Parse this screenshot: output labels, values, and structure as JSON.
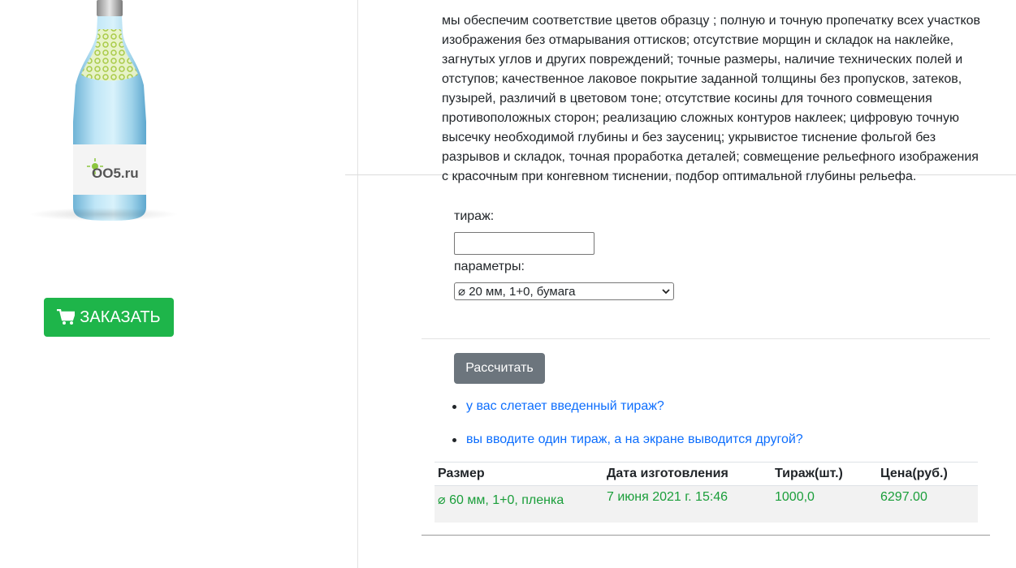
{
  "product": {
    "brand_label": "OO5.ru",
    "order_button_label": "ЗАКАЗАТЬ"
  },
  "description": {
    "lines": [
      "мы обеспечим соответствие цветов образцу ; полную и точную пропечатку всех участков",
      "изображения без отмарывания оттисков; отсутствие морщин и складок на наклейке,",
      "загнутых углов и других повреждений; точные размеры, наличие технических полей и",
      "отступов; качественное лаковое покрытие заданной толщины без пропусков, затеков,",
      "пузырей, различий в цветовом тоне; отсутствие косины для точного совмещения",
      "противоположных сторон; реализацию сложных контуров наклеек; цифровую точную",
      "высечку необходимой глубины и без заусениц; укрывистое тиснение фольгой без",
      "разрывов и складок, точная проработка деталей; совмещение рельефного изображения",
      "с красочным при конгевном тиснении, подбор оптимальной глубины рельефа."
    ]
  },
  "form": {
    "quantity_label": "тираж:",
    "quantity_value": "",
    "params_label": "параметры:",
    "params_selected": "⌀ 20 мм, 1+0, бумага",
    "calc_button_label": "Рассчитать"
  },
  "faq_links": [
    "у вас слетает введенный тираж?",
    "вы вводите один тираж, а на экране выводится другой?"
  ],
  "results_table": {
    "headers": [
      "Размер",
      "Дата изготовления",
      "Тираж(шт.)",
      "Цена(руб.)"
    ],
    "rows": [
      [
        "⌀ 60 мм, 1+0, пленка",
        "7 июня 2021 г. 15:46",
        "1000,0",
        "6297.00"
      ]
    ]
  },
  "colors": {
    "order_button": "#1eb54a",
    "calc_button": "#6c757d",
    "link": "#0d6efd",
    "result_text": "#1a9e3a"
  },
  "icons": {
    "order_button_icon": "cart-icon",
    "select_icon": "chevron-down-icon"
  }
}
